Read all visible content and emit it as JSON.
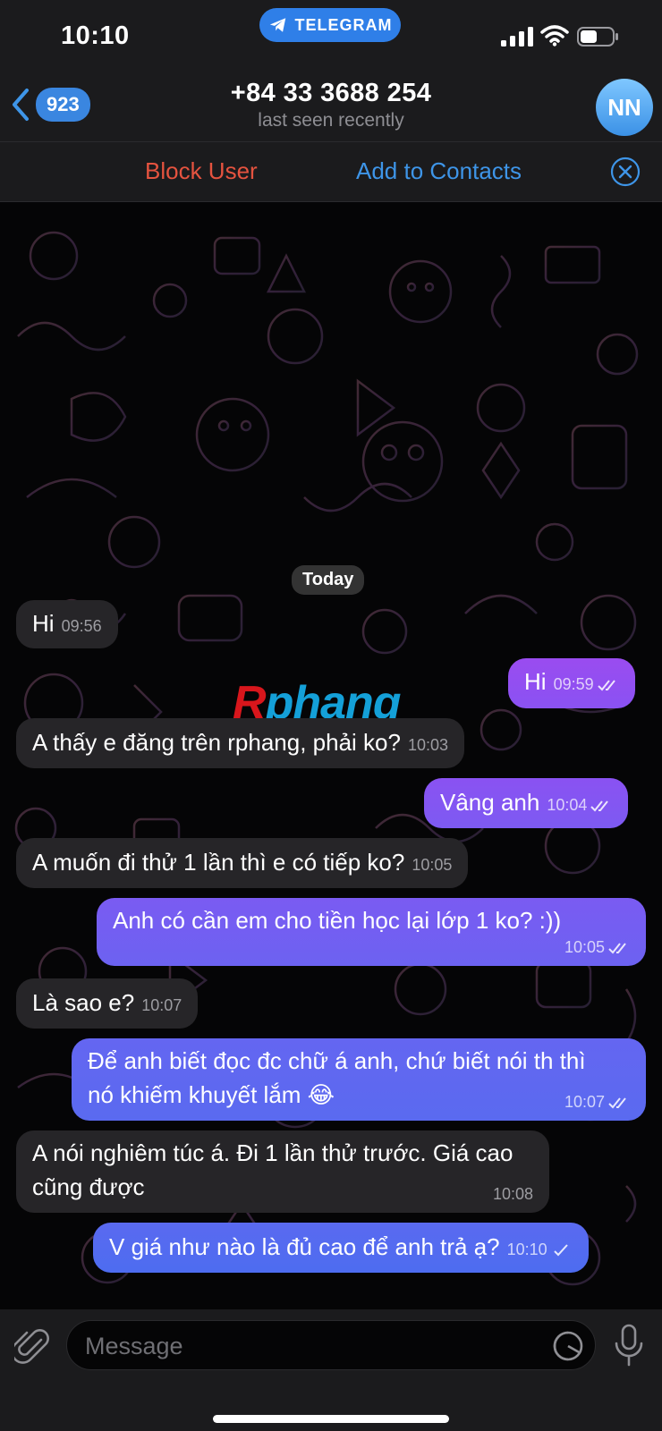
{
  "status_bar": {
    "time": "10:10",
    "app_pill": "TELEGRAM"
  },
  "header": {
    "back_count": "923",
    "title": "+84 33 3688 254",
    "subtitle": "last seen recently",
    "avatar_initials": "NN"
  },
  "action_bar": {
    "block_label": "Block User",
    "add_label": "Add to Contacts"
  },
  "chat": {
    "date_label": "Today",
    "watermark_first": "R",
    "watermark_rest": "phang",
    "messages": [
      {
        "dir": "in",
        "text": "Hi",
        "time": "09:56"
      },
      {
        "dir": "out",
        "text": "Hi",
        "time": "09:59",
        "read": true
      },
      {
        "dir": "in",
        "text": "A thấy e đăng trên rphang, phải ko?",
        "time": "10:03"
      },
      {
        "dir": "out",
        "text": "Vâng anh",
        "time": "10:04",
        "read": true
      },
      {
        "dir": "in",
        "text": "A muốn đi thử 1 lần thì e có tiếp ko?",
        "time": "10:05"
      },
      {
        "dir": "out",
        "text": "Anh có cần em cho tiền học lại lớp 1 ko? :))",
        "time": "10:05",
        "read": true
      },
      {
        "dir": "in",
        "text": "Là sao e?",
        "time": "10:07"
      },
      {
        "dir": "out",
        "text": "Để anh biết đọc đc chữ á anh, chứ biết nói th thì nó khiếm khuyết lắm 😂",
        "time": "10:07",
        "read": true
      },
      {
        "dir": "in",
        "text": "A nói nghiêm túc á. Đi 1 lần thử trước. Giá cao cũng được",
        "time": "10:08"
      },
      {
        "dir": "out",
        "text": "V giá như nào là đủ cao để anh trả ạ?",
        "time": "10:10",
        "read": false
      }
    ]
  },
  "input": {
    "placeholder": "Message"
  },
  "colors": {
    "accent_blue": "#3e95e8",
    "block_red": "#e5533f",
    "incoming_bubble": "#262528",
    "outgoing_gradient_top": "#9a4cf0",
    "outgoing_gradient_bottom": "#4d6cf0"
  }
}
